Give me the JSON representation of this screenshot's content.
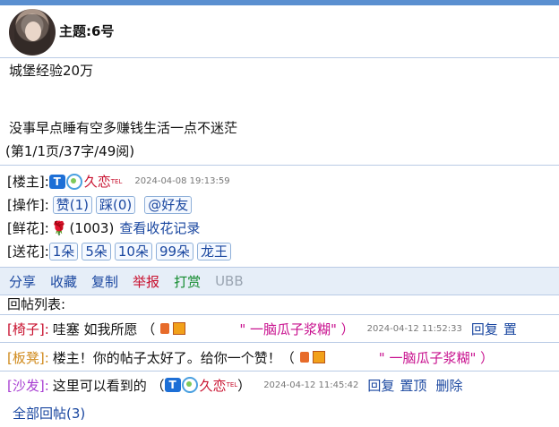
{
  "topic": {
    "title": "主题:6号"
  },
  "content": {
    "line1": "城堡经验20万",
    "line2": "没事早点睡有空多赚钱生活一点不迷茫",
    "meta": "(第1/1页/37字/49阅)"
  },
  "info": {
    "author_label": "[楼主]:",
    "author_name": "久恋",
    "author_tel": "TEL",
    "author_time": "2024-04-08 19:13:59",
    "ops_label": "[操作]:",
    "like": "赞(1)",
    "dislike": "踩(0)",
    "at_friend": "@好友",
    "flower_label": "[鲜花]:",
    "flower_count": "(1003)",
    "flower_link": "查看收花记录",
    "send_label": "[送花]:",
    "send_1": "1朵",
    "send_5": "5朵",
    "send_10": "10朵",
    "send_99": "99朵",
    "send_king": "龙王"
  },
  "actions": {
    "share": "分享",
    "favorite": "收藏",
    "copy": "复制",
    "report": "举报",
    "tip": "打赏",
    "ubb": "UBB"
  },
  "replies_title": "回帖列表:",
  "replies": [
    {
      "floor": "[椅子]:",
      "text": "哇塞 如我所愿 （",
      "nick": "\" 一脑瓜子浆糊\" ）",
      "time": "2024-04-12 11:52:33",
      "reply": "回复",
      "top": "置"
    },
    {
      "floor": "[板凳]:",
      "text": "楼主！你的帖子太好了。给你一个赞！（",
      "nick": "\" 一脑瓜子浆糊\" ）"
    },
    {
      "floor": "[沙发]:",
      "text": "这里可以看到的 （",
      "nick": "久恋",
      "tel": "TEL",
      "close": "）",
      "time": "2024-04-12 11:45:42",
      "reply": "回复",
      "top": "置顶",
      "delete": "删除"
    }
  ],
  "all_replies": "全部回帖(3)"
}
